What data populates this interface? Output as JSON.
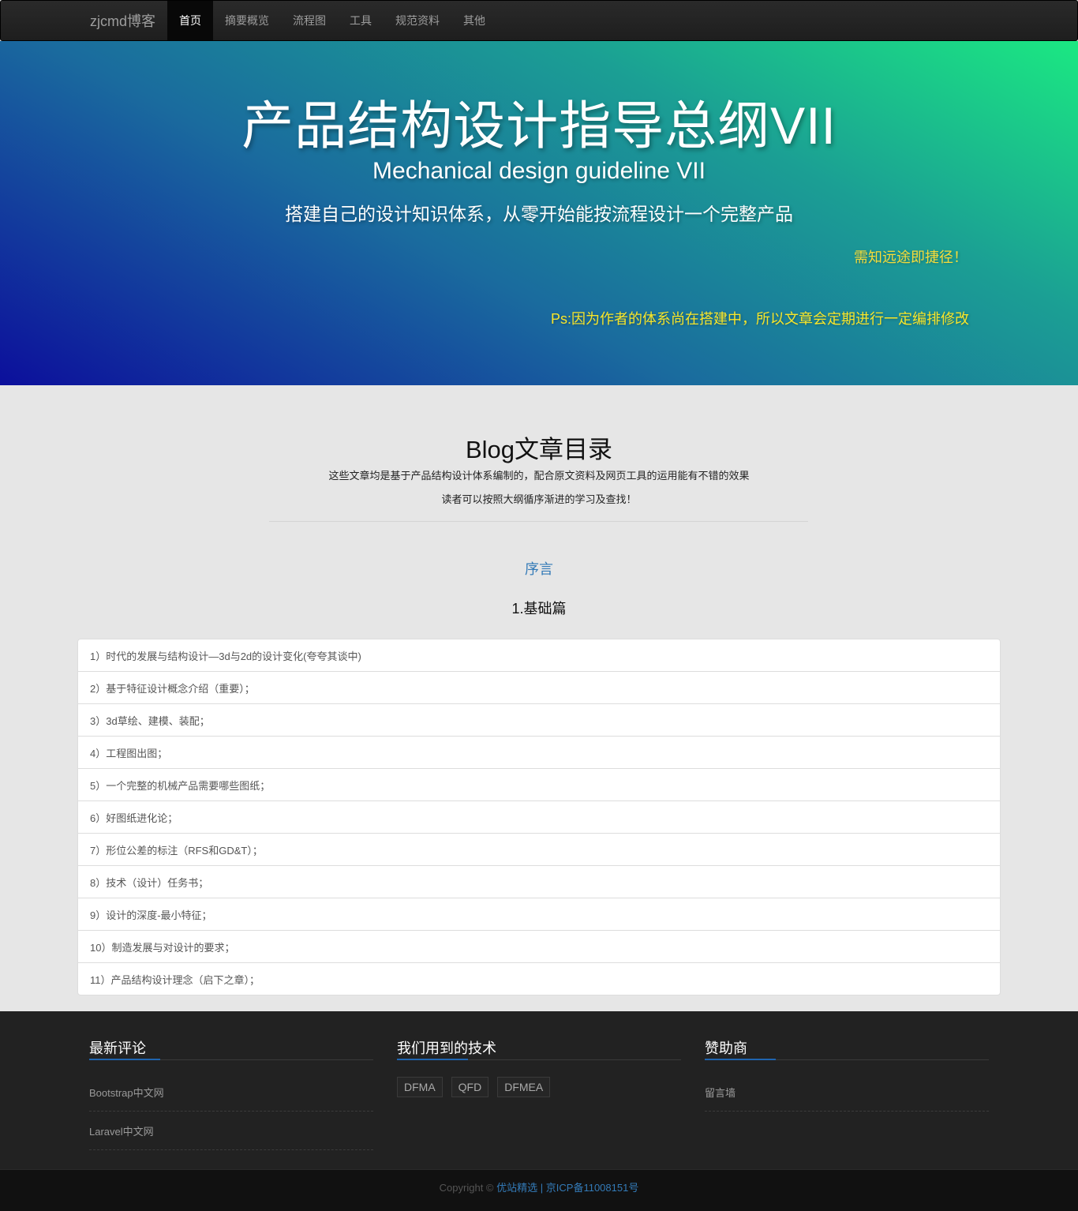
{
  "nav": {
    "brand": "zjcmd博客",
    "items": [
      {
        "label": "首页",
        "active": true
      },
      {
        "label": "摘要概览"
      },
      {
        "label": "流程图"
      },
      {
        "label": "工具"
      },
      {
        "label": "规范资料"
      },
      {
        "label": "其他"
      }
    ]
  },
  "hero": {
    "title": "产品结构设计指导总纲VII",
    "subtitle": "Mechanical design guideline VII",
    "tagline": "搭建自己的设计知识体系，从零开始能按流程设计一个完整产品",
    "motto": "需知远途即捷径！",
    "note": "Ps:因为作者的体系尚在搭建中，所以文章会定期进行一定编排修改"
  },
  "catalog": {
    "title": "Blog文章目录",
    "desc1": "这些文章均是基于产品结构设计体系编制的，配合原文资料及网页工具的运用能有不错的效果",
    "desc2": "读者可以按照大纲循序渐进的学习及查找！",
    "preface": "序言",
    "chapter": "1.基础篇",
    "items": [
      "1）时代的发展与结构设计—3d与2d的设计变化(夸夸其谈中)",
      "2）基于特征设计概念介绍（重要）；",
      "3）3d草绘、建模、装配；",
      "4）工程图出图；",
      "5）一个完整的机械产品需要哪些图纸；",
      "6）好图纸进化论；",
      "7）形位公差的标注（RFS和GD&T）；",
      "8）技术（设计）任务书；",
      "9）设计的深度-最小特征；",
      "10）制造发展与对设计的要求；",
      "11）产品结构设计理念（启下之章）；"
    ]
  },
  "footer": {
    "col1": {
      "title": "最新评论",
      "links": [
        "Bootstrap中文网",
        "Laravel中文网"
      ]
    },
    "col2": {
      "title": "我们用到的技术",
      "tags": [
        "DFMA",
        "QFD",
        "DFMEA"
      ]
    },
    "col3": {
      "title": "赞助商",
      "links": [
        "留言墙"
      ]
    },
    "copyright_prefix": "Copyright ©",
    "copyright_site": "优站精选",
    "copyright_sep": "|",
    "copyright_icp": "京ICP备11008151号"
  },
  "colors": {
    "accent": "#337ab7",
    "hero_yellow": "#f5dc3a",
    "footer_bg": "#222222"
  }
}
